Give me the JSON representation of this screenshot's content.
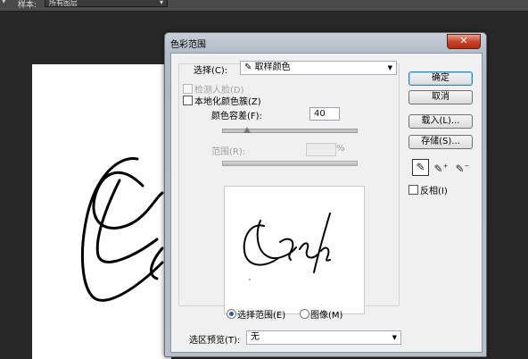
{
  "app": {
    "options_bar": {
      "label": "样本:",
      "select_value": "所有图层"
    }
  },
  "dialog": {
    "title": "色彩范围",
    "close_glyph": "✕",
    "select": {
      "label": "选择(C):",
      "value": "取样颜色",
      "icon": "eyedropper-icon"
    },
    "detect_faces": {
      "label": "检测人脸(D)",
      "checked": false,
      "enabled": false
    },
    "localized_clusters": {
      "label": "本地化颜色簇(Z)",
      "checked": false,
      "enabled": true
    },
    "fuzziness": {
      "label": "颜色容差(F):",
      "value": "40"
    },
    "range": {
      "label": "范围(R):",
      "value": "",
      "unit": "%"
    },
    "view_mode": {
      "options": [
        {
          "label": "选择范围(E)",
          "selected": true
        },
        {
          "label": "图像(M)",
          "selected": false
        }
      ]
    },
    "selection_preview": {
      "label": "选区预览(T):",
      "value": "无"
    },
    "buttons": {
      "ok": "确定",
      "cancel": "取消",
      "load": "载入(L)...",
      "save": "存储(S)..."
    },
    "eyedroppers": [
      {
        "name": "eyedropper-icon",
        "active": true
      },
      {
        "name": "eyedropper-plus-icon",
        "active": false
      },
      {
        "name": "eyedropper-minus-icon",
        "active": false
      }
    ],
    "invert": {
      "label": "反相(I)",
      "checked": false
    }
  },
  "colors": {
    "window_bg": "#282828",
    "dialog_frame": "#b4bec8",
    "close_button": "#c9452d",
    "default_button_border": "#3c7fb1"
  }
}
